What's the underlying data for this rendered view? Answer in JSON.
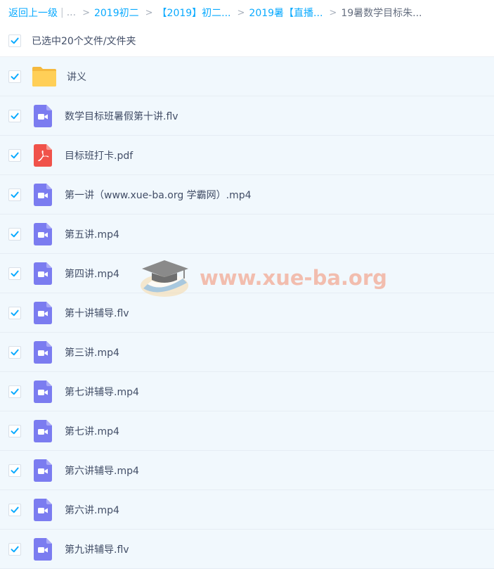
{
  "breadcrumb": {
    "back": "返回上一级",
    "divider": "|",
    "ellipsis": "...",
    "arrow": ">",
    "crumbs": [
      "2019初二",
      "【2019】初二...",
      "2019暑【直播...",
      "19暑数学目标朱..."
    ]
  },
  "selection": {
    "text": "已选中20个文件/文件夹",
    "checked": true
  },
  "files": [
    {
      "name": "讲义",
      "type": "folder",
      "checked": true
    },
    {
      "name": "数学目标班暑假第十讲.flv",
      "type": "video",
      "checked": true
    },
    {
      "name": "目标班打卡.pdf",
      "type": "pdf",
      "checked": true
    },
    {
      "name": "第一讲（www.xue-ba.org 学霸网）.mp4",
      "type": "video",
      "checked": true
    },
    {
      "name": "第五讲.mp4",
      "type": "video",
      "checked": true
    },
    {
      "name": "第四讲.mp4",
      "type": "video",
      "checked": true
    },
    {
      "name": "第十讲辅导.flv",
      "type": "video",
      "checked": true
    },
    {
      "name": "第三讲.mp4",
      "type": "video",
      "checked": true
    },
    {
      "name": "第七讲辅导.mp4",
      "type": "video",
      "checked": true
    },
    {
      "name": "第七讲.mp4",
      "type": "video",
      "checked": true
    },
    {
      "name": "第六讲辅导.mp4",
      "type": "video",
      "checked": true
    },
    {
      "name": "第六讲.mp4",
      "type": "video",
      "checked": true
    },
    {
      "name": "第九讲辅导.flv",
      "type": "video",
      "checked": true
    }
  ],
  "watermark": {
    "text": "www.xue-ba.org"
  },
  "colors": {
    "link": "#09aaff",
    "check": "#09aaff",
    "row_bg": "#f1f8fd",
    "video_icon": "#7b7cf0",
    "pdf_icon": "#f0524a",
    "folder_icon": "#ffc94a"
  }
}
